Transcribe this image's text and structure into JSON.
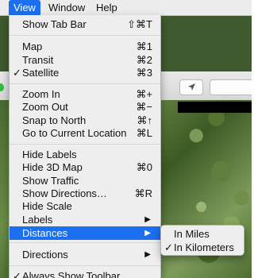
{
  "menubar": {
    "items": [
      {
        "label": "View",
        "active": true
      },
      {
        "label": "Window",
        "active": false
      },
      {
        "label": "Help",
        "active": false
      }
    ]
  },
  "view_menu": {
    "items": [
      {
        "label": "Show Tab Bar",
        "shortcut": "⇧⌘T",
        "checked": false
      },
      {
        "label": "Map",
        "shortcut": "⌘1",
        "checked": false
      },
      {
        "label": "Transit",
        "shortcut": "⌘2",
        "checked": false
      },
      {
        "label": "Satellite",
        "shortcut": "⌘3",
        "checked": true
      },
      {
        "label": "Zoom In",
        "shortcut": "⌘+",
        "checked": false
      },
      {
        "label": "Zoom Out",
        "shortcut": "⌘−",
        "checked": false
      },
      {
        "label": "Snap to North",
        "shortcut": "⌘↑",
        "checked": false
      },
      {
        "label": "Go to Current Location",
        "shortcut": "⌘L",
        "checked": false
      },
      {
        "label": "Hide Labels",
        "shortcut": "",
        "checked": false
      },
      {
        "label": "Hide 3D Map",
        "shortcut": "⌘0",
        "checked": false
      },
      {
        "label": "Show Traffic",
        "shortcut": "",
        "checked": false
      },
      {
        "label": "Show Directions…",
        "shortcut": "⌘R",
        "checked": false
      },
      {
        "label": "Hide Scale",
        "shortcut": "",
        "checked": false
      },
      {
        "label": "Labels",
        "shortcut": "",
        "checked": false,
        "submenu": true
      },
      {
        "label": "Distances",
        "shortcut": "",
        "checked": false,
        "submenu": true,
        "highlighted": true
      },
      {
        "label": "Directions",
        "shortcut": "",
        "checked": false,
        "submenu": true
      },
      {
        "label": "Always Show Toolbar",
        "shortcut": "",
        "checked": true
      }
    ],
    "check_mark": "✓",
    "submenu_arrow": "▶"
  },
  "distances_submenu": {
    "items": [
      {
        "label": "In Miles",
        "checked": false
      },
      {
        "label": "In Kilometers",
        "checked": true
      }
    ]
  },
  "colors": {
    "highlight": "#1b6ff0",
    "menu_bg": "#eeeeee"
  }
}
